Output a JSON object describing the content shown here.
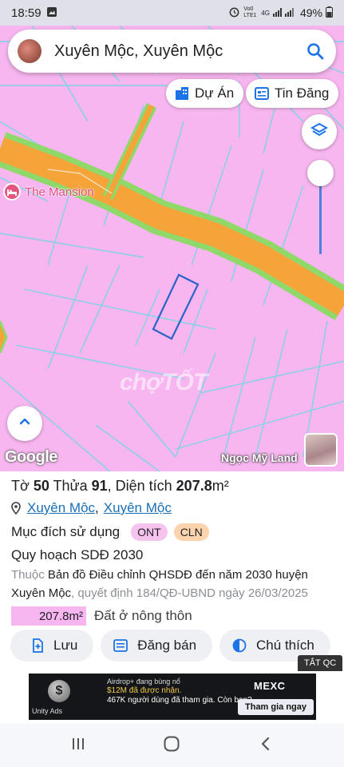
{
  "status_bar": {
    "time": "18:59",
    "net_label": "Vo0 LTE1",
    "net_label2": "4G",
    "battery": "49%"
  },
  "search": {
    "query": "Xuyên Mộc, Xuyên Mộc"
  },
  "chips": {
    "project": "Dự Án",
    "listings": "Tin Đăng"
  },
  "map": {
    "poi_label": "The Mansion",
    "watermark": "chợTỐT",
    "google_logo": "Google",
    "agent_name": "Ngọc Mỹ Land",
    "zoom_level": 0.2
  },
  "plot": {
    "to_label": "Tờ ",
    "to_value": "50",
    "thua_label": " Thửa ",
    "thua_value": "91",
    "area_label": ", Diện tích ",
    "area_value": "207.8",
    "area_unit": "m²",
    "commune": "Xuyên Mộc",
    "district": "Xuyên Mộc",
    "purpose_label": "Mục đích sử dụng",
    "tag_ont": "ONT",
    "tag_cln": "CLN",
    "plan_label": "Quy hoạch SDĐ 2030",
    "source_prefix": "Thuộc ",
    "source_main": "Bản đồ Điều chỉnh QHSDĐ đến năm 2030 huyện Xuyên Mộc",
    "source_suffix": ", quyết định 184/QĐ-UBND ngày 26/03/2025",
    "area_swatch_value": "207.8m²",
    "area_desc": "Đất ở nông thôn"
  },
  "actions": {
    "save": "Lưu",
    "post": "Đăng bán",
    "legend": "Chú thích"
  },
  "ad": {
    "close_label": "TẮT QC",
    "line1": "Airdrop+ đang bùng nổ",
    "line2": "$12M đã được nhận.",
    "line3": "467K người dùng đã tham gia. Còn bạn?",
    "brand": "MEXC",
    "cta": "Tham gia ngay",
    "network": "Unity Ads",
    "coin": "$"
  },
  "colors": {
    "map_bg": "#f7b6ef",
    "road": "#f5a43a",
    "road_edge": "#8fd96a",
    "parcel_line": "#7fd3e6",
    "selected_parcel": "#2a64c8",
    "link": "#1a6fb8"
  }
}
